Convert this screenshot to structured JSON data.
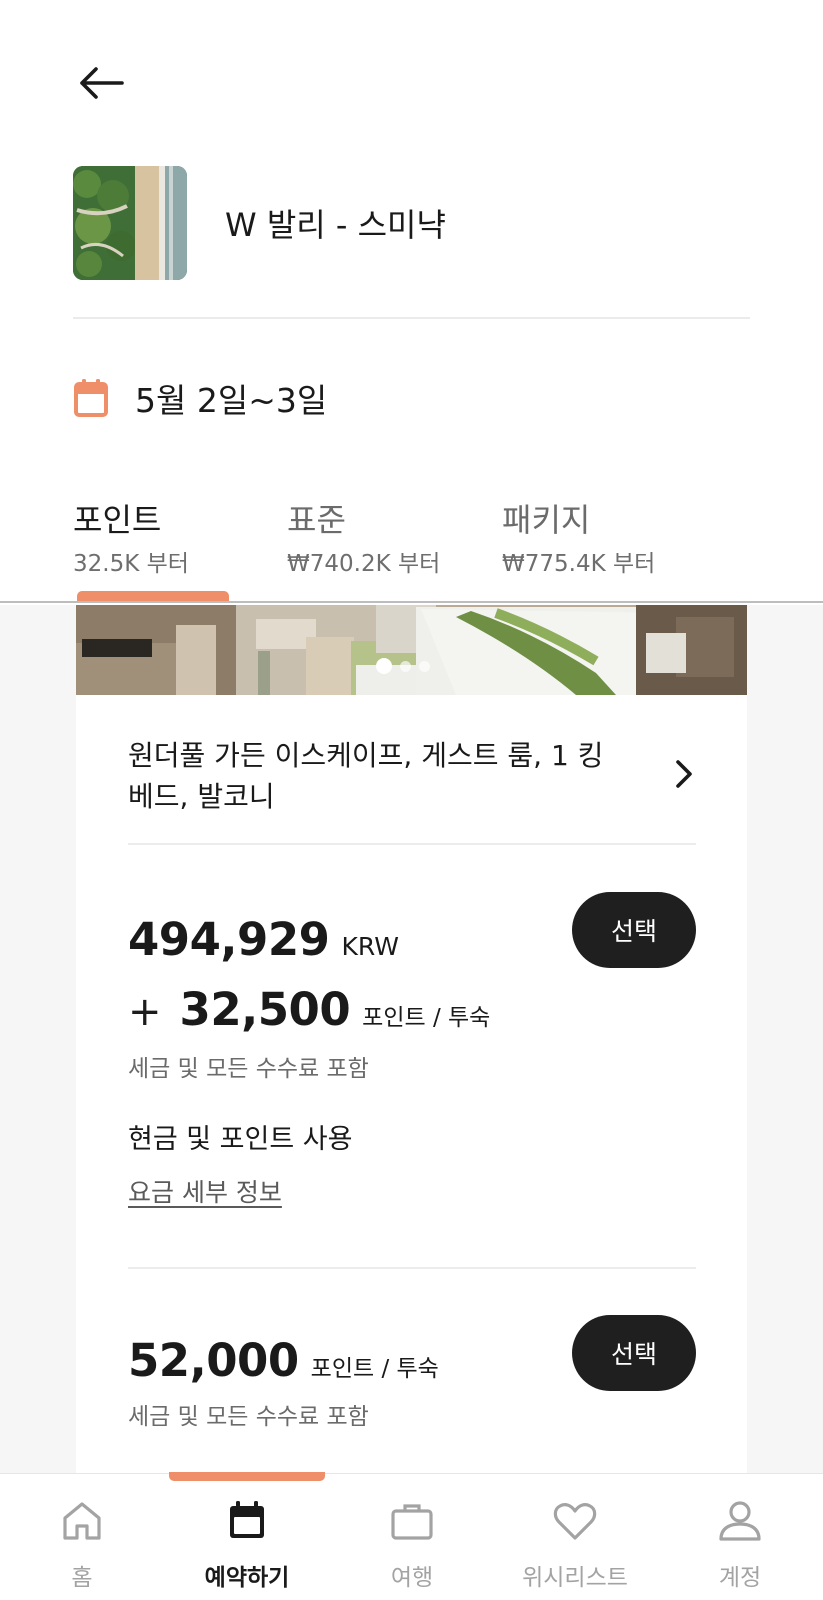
{
  "header": {
    "hotel_name": "W 발리 - 스미냑",
    "dates": "5월 2일~3일"
  },
  "tabs": [
    {
      "label": "포인트",
      "sub": "32.5K 부터"
    },
    {
      "label": "표준",
      "sub": "₩740.2K 부터"
    },
    {
      "label": "패키지",
      "sub": "₩775.4K 부터"
    }
  ],
  "room": {
    "title": "원더풀 가든 이스케이프, 게스트 룸, 1 킹베드, 발코니",
    "image_count": 3,
    "active_image": 1
  },
  "rate1": {
    "amount": "494,929",
    "currency": "KRW",
    "plus": "+",
    "points": "32,500",
    "points_unit": "포인트 / 투숙",
    "tax_note": "세금 및 모든 수수료 포함",
    "payment_type": "현금 및 포인트 사용",
    "details_link": "요금 세부 정보",
    "select_label": "선택"
  },
  "rate2": {
    "points": "52,000",
    "points_unit": "포인트 / 투숙",
    "tax_note": "세금 및 모든 수수료 포함",
    "select_label": "선택"
  },
  "nav": [
    {
      "label": "홈",
      "icon": "home-icon"
    },
    {
      "label": "예약하기",
      "icon": "calendar-icon"
    },
    {
      "label": "여행",
      "icon": "briefcase-icon"
    },
    {
      "label": "위시리스트",
      "icon": "heart-icon"
    },
    {
      "label": "계정",
      "icon": "person-icon"
    }
  ],
  "colors": {
    "accent": "#ee8f6a",
    "button": "#1f1f1f",
    "text": "#1a1a1a",
    "muted": "#6b6b6b"
  }
}
